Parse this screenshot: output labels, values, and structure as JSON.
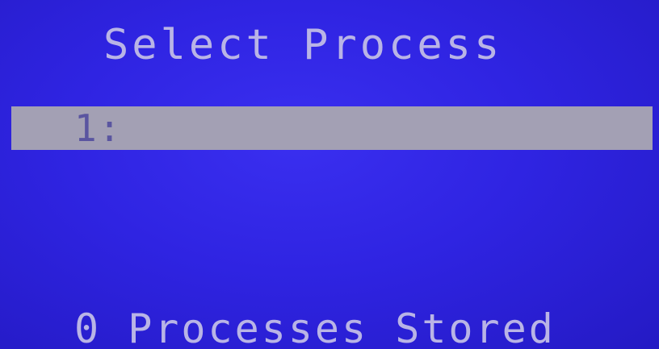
{
  "screen": {
    "title": "Select Process",
    "selected_item": "1:",
    "status": "0  Processes Stored"
  },
  "colors": {
    "background": "#2f24e2",
    "text": "#b9b4e6",
    "highlight_bar": "#a3a0b4",
    "highlight_text": "#5a55a0"
  }
}
